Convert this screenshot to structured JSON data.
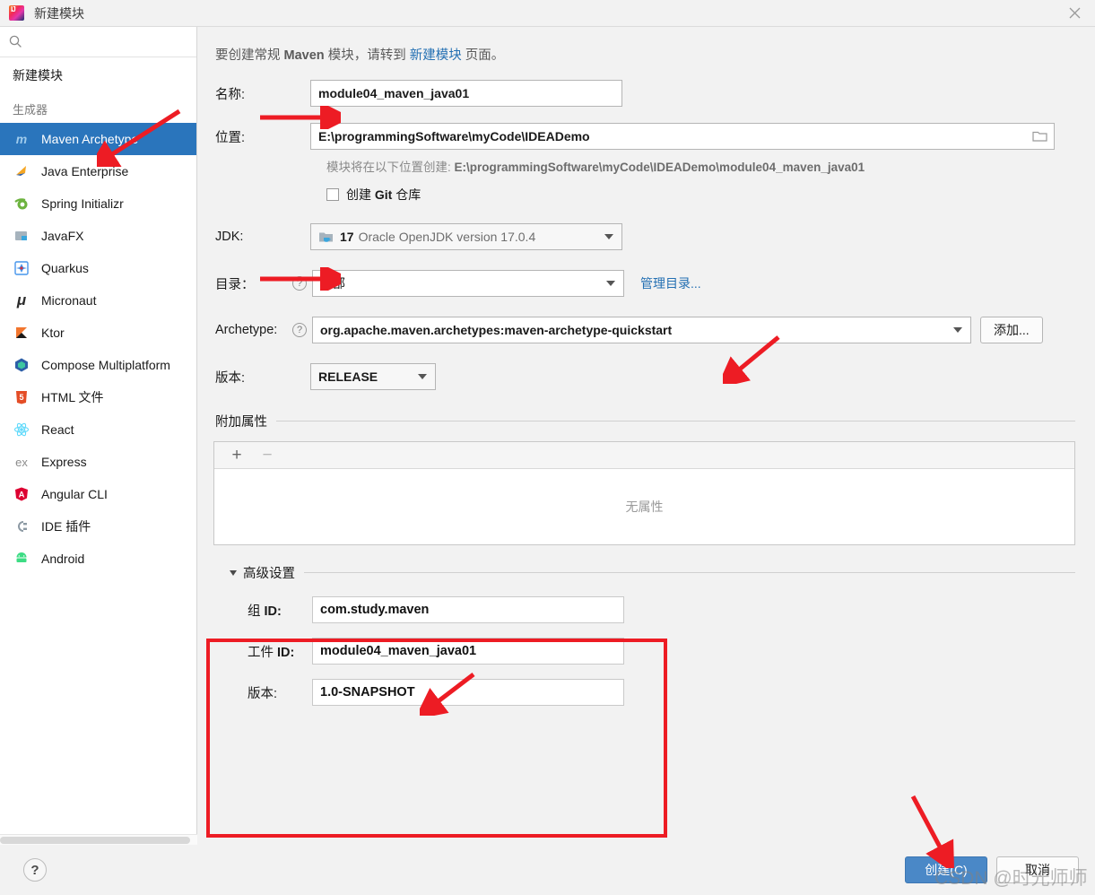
{
  "window": {
    "title": "新建模块",
    "logo_icon": "intellij-idea-logo",
    "close_icon": "close-icon"
  },
  "sidebar": {
    "search": {
      "value": "",
      "placeholder": "",
      "icon": "search-icon"
    },
    "root_item": "新建模块",
    "group_label": "生成器",
    "items": [
      {
        "label": "Maven Archetype",
        "icon": "maven-icon",
        "glyph": "m",
        "color": "#73b1e0",
        "selected": true
      },
      {
        "label": "Java Enterprise",
        "icon": "java-enterprise-icon",
        "glyph": "◤",
        "color": "#f5a623",
        "selected": false
      },
      {
        "label": "Spring Initializr",
        "icon": "spring-icon",
        "glyph": "❀",
        "color": "#6db33f",
        "selected": false
      },
      {
        "label": "JavaFX",
        "icon": "javafx-icon",
        "glyph": "▤",
        "color": "#9aa7b0",
        "selected": false
      },
      {
        "label": "Quarkus",
        "icon": "quarkus-icon",
        "glyph": "✦",
        "color": "#4695eb",
        "selected": false
      },
      {
        "label": "Micronaut",
        "icon": "micronaut-icon",
        "glyph": "μ",
        "color": "#2b2b2b",
        "selected": false
      },
      {
        "label": "Ktor",
        "icon": "ktor-icon",
        "glyph": "◣",
        "color": "#f2762e",
        "selected": false
      },
      {
        "label": "Compose Multiplatform",
        "icon": "compose-icon",
        "glyph": "⬢",
        "color": "#2d5fa8",
        "selected": false
      },
      {
        "label": "HTML 文件",
        "icon": "html-icon",
        "glyph": "5",
        "color": "#e44d26",
        "selected": false
      },
      {
        "label": "React",
        "icon": "react-icon",
        "glyph": "⚛",
        "color": "#61dafb",
        "selected": false
      },
      {
        "label": "Express",
        "icon": "express-icon",
        "glyph": "ex",
        "color": "#8c8c8c",
        "selected": false
      },
      {
        "label": "Angular CLI",
        "icon": "angular-icon",
        "glyph": "A",
        "color": "#dd0031",
        "selected": false
      },
      {
        "label": "IDE 插件",
        "icon": "ide-plugin-icon",
        "glyph": "⚲",
        "color": "#9aa7b0",
        "selected": false
      },
      {
        "label": "Android",
        "icon": "android-icon",
        "glyph": "▰",
        "color": "#3ddc84",
        "selected": false
      }
    ]
  },
  "main": {
    "description": {
      "prefix": "要创建常规 ",
      "bold1": "Maven",
      "middle": " 模块，请转到 ",
      "link": "新建模块",
      "suffix": " 页面。"
    },
    "name": {
      "label": "名称:",
      "value": "module04_maven_java01"
    },
    "location": {
      "label": "位置:",
      "value": "E:\\programmingSoftware\\myCode\\IDEADemo",
      "browse_icon": "folder-icon",
      "hint_prefix": "模块将在以下位置创建: ",
      "hint_path": "E:\\programmingSoftware\\myCode\\IDEADemo\\module04_maven_java01"
    },
    "git": {
      "label_prefix": "创建 ",
      "label_bold": "Git",
      "label_suffix": " 仓库",
      "checked": false
    },
    "jdk": {
      "label": "JDK:",
      "version": "17",
      "name": "Oracle OpenJDK version 17.0.4",
      "icon": "jdk-folder-icon"
    },
    "catalog": {
      "label": "目录：",
      "help_icon": "help-icon",
      "value": "内部",
      "manage_link": "管理目录..."
    },
    "archetype": {
      "label": "Archetype:",
      "help_icon": "help-icon",
      "value": "org.apache.maven.archetypes:maven-archetype-quickstart",
      "add_button": "添加..."
    },
    "version": {
      "label": "版本:",
      "value": "RELEASE"
    },
    "properties": {
      "section_title": "附加属性",
      "add_icon": "plus-icon",
      "remove_icon": "minus-icon",
      "empty_text": "无属性"
    },
    "advanced": {
      "title": "高级设置",
      "expanded": true,
      "chevron_icon": "chevron-down-icon",
      "group_id": {
        "label_prefix": "组 ",
        "label_suffix": "ID:",
        "value": "com.study.maven"
      },
      "artifact_id": {
        "label_prefix": "工件 ",
        "label_suffix": "ID:",
        "value": "module04_maven_java01"
      },
      "version": {
        "label": "版本:",
        "value": "1.0-SNAPSHOT"
      }
    }
  },
  "footer": {
    "help_icon": "help-icon",
    "help_label": "?",
    "create_button": "创建(C)",
    "cancel_button": "取消"
  },
  "annotations": {
    "accent_color": "#ed1c24",
    "watermark": "CSDN @时光师师"
  }
}
